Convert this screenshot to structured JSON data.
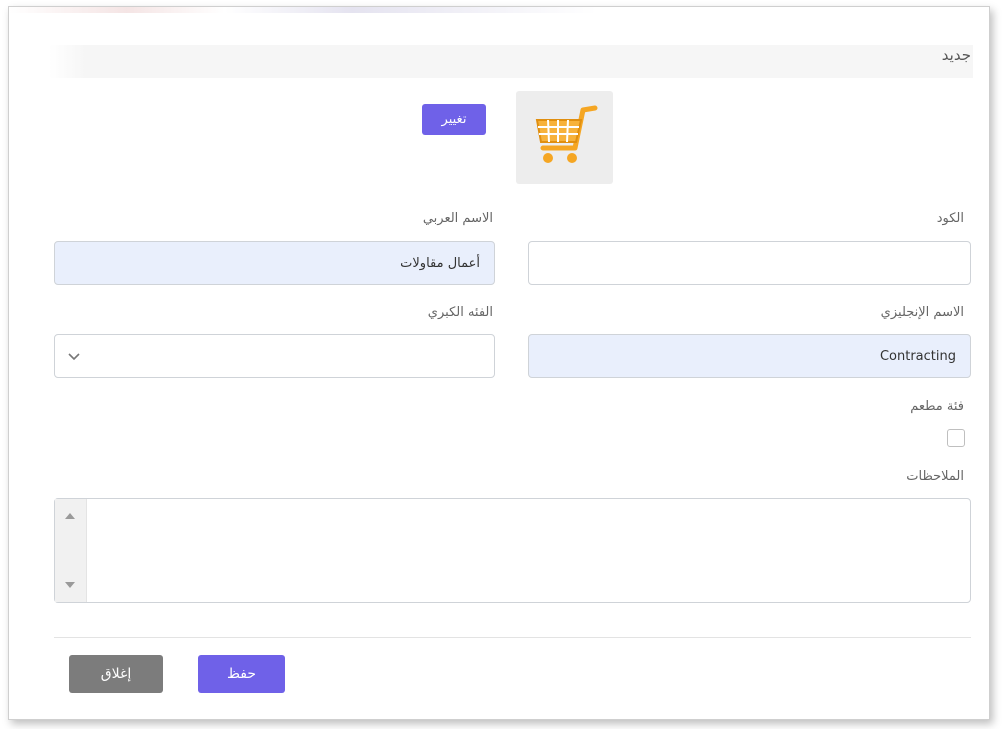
{
  "dialog": {
    "title": "جديد",
    "change_button": "تغيير",
    "image_icon": "shopping-cart-icon"
  },
  "form": {
    "code_label": "الكود",
    "code_value": "",
    "arabic_name_label": "الاسم العربي",
    "arabic_name_value": "أعمال مقاولات",
    "english_name_label": "الاسم الإنجليزي",
    "english_name_value": "Contracting",
    "main_category_label": "الفئه الكبري",
    "main_category_value": "",
    "restaurant_category_label": "فئة مطعم",
    "restaurant_category_checked": false,
    "notes_label": "الملاحظات",
    "notes_value": ""
  },
  "footer": {
    "save_label": "حفظ",
    "close_label": "إغلاق"
  },
  "colors": {
    "accent": "#6f61e8",
    "close_button": "#7c7c7c",
    "filled_input": "#e9effc",
    "cart": "#f5a623"
  }
}
